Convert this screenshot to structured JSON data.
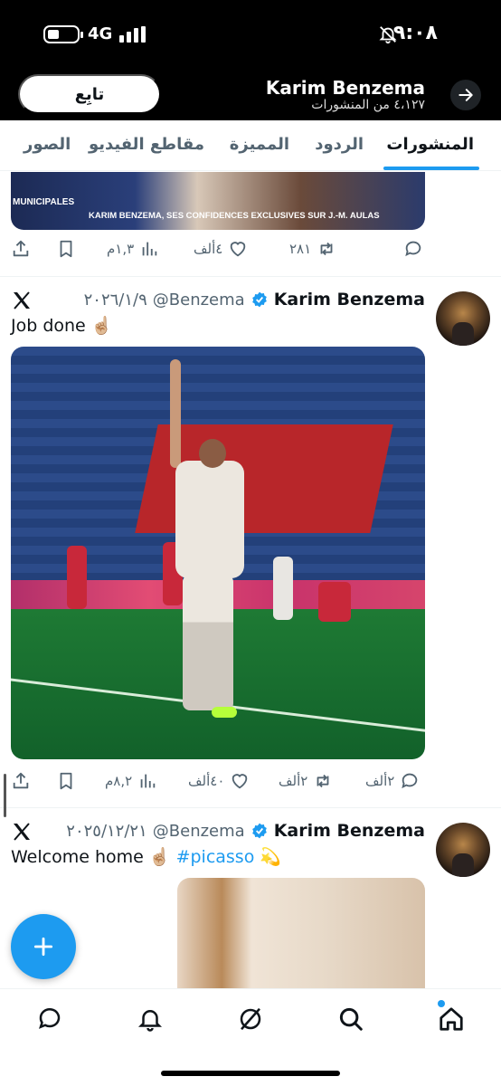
{
  "status_bar": {
    "network": "4G",
    "time": "٩:٠٨"
  },
  "header": {
    "name": "Karim Benzema",
    "posts_count": "٤،١٢٧ من المنشورات",
    "follow_label": "تابِع"
  },
  "tabs": [
    {
      "label": "المنشورات",
      "active": true
    },
    {
      "label": "الردود",
      "active": false
    },
    {
      "label": "المميزة",
      "active": false
    },
    {
      "label": "مقاطع الفيديو",
      "active": false
    },
    {
      "label": "الصور",
      "active": false
    }
  ],
  "posts": [
    {
      "media_caption": "KARIM BENZEMA, SES CONFIDENCES EXCLUSIVES SUR J.-M. AULAS",
      "media_logo": "MUNICIPALES",
      "replies": "",
      "reposts": "٢٨١",
      "likes": "٤ألف",
      "views": "١,٣م"
    },
    {
      "name": "Karim Benzema",
      "handle": "@Benzema",
      "date": "٢٠٢٦/١/٩",
      "text": "Job done ☝🏼",
      "replies": "٢ألف",
      "reposts": "٢ألف",
      "likes": "٤٠ألف",
      "views": "٨,٢م"
    },
    {
      "name": "Karim Benzema",
      "handle": "@Benzema",
      "date": "٢٠٢٥/١٢/٢١",
      "text_prefix": "Welcome home ☝🏼",
      "hashtag": "#picasso",
      "text_suffix": "💫"
    }
  ],
  "colors": {
    "accent": "#1d9bf0",
    "verified": "#1d9bf0",
    "text_secondary": "#536471"
  },
  "nav": [
    "messages-icon",
    "notifications-icon",
    "grok-icon",
    "search-icon",
    "home-icon"
  ]
}
